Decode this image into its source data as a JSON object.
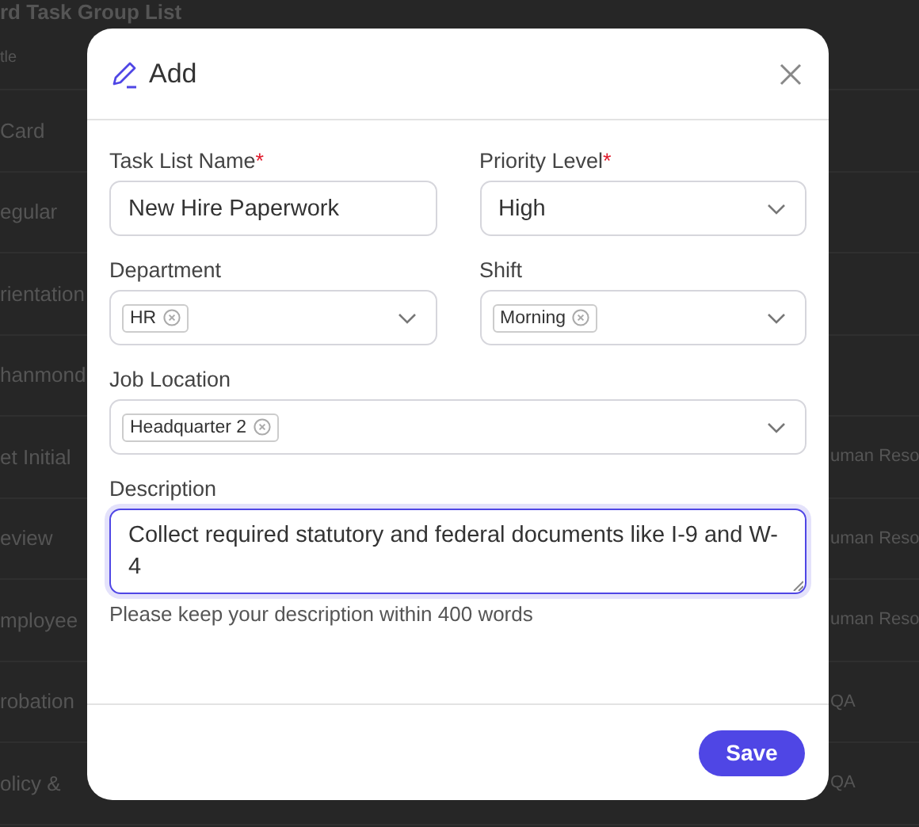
{
  "background": {
    "title": "rd Task Group List",
    "rows": [
      {
        "left": "tle"
      },
      {
        "left": "Card"
      },
      {
        "left": "egular"
      },
      {
        "left": "rientation"
      },
      {
        "left": "hanmond"
      },
      {
        "left": "et Initial",
        "right": "uman Reso"
      },
      {
        "left": "eview",
        "right": "uman Reso"
      },
      {
        "left": "mployee",
        "right": "uman Reso"
      },
      {
        "left": "robation",
        "right": "QA"
      },
      {
        "left": "olicy &",
        "right": "QA"
      }
    ]
  },
  "dialog": {
    "title": "Add",
    "required_mark": "*",
    "rows": [
      {
        "fields": [
          {
            "kind": "text",
            "label": "Task List Name",
            "required": true,
            "value": "New Hire Paperwork"
          },
          {
            "kind": "select",
            "label": "Priority Level",
            "required": true,
            "value": "High"
          }
        ]
      },
      {
        "fields": [
          {
            "kind": "tags",
            "label": "Department",
            "required": false,
            "tags": [
              "HR"
            ]
          },
          {
            "kind": "tags",
            "label": "Shift",
            "required": false,
            "tags": [
              "Morning"
            ]
          }
        ]
      },
      {
        "fields": [
          {
            "kind": "tags",
            "label": "Job Location",
            "required": false,
            "tags": [
              "Headquarter 2"
            ]
          }
        ]
      },
      {
        "fields": [
          {
            "kind": "textarea",
            "label": "Description",
            "required": false,
            "value": "Collect required statutory and federal documents like I-9 and W-4",
            "hint": "Please keep your description within 400 words"
          }
        ]
      }
    ],
    "save_button": "Save"
  }
}
